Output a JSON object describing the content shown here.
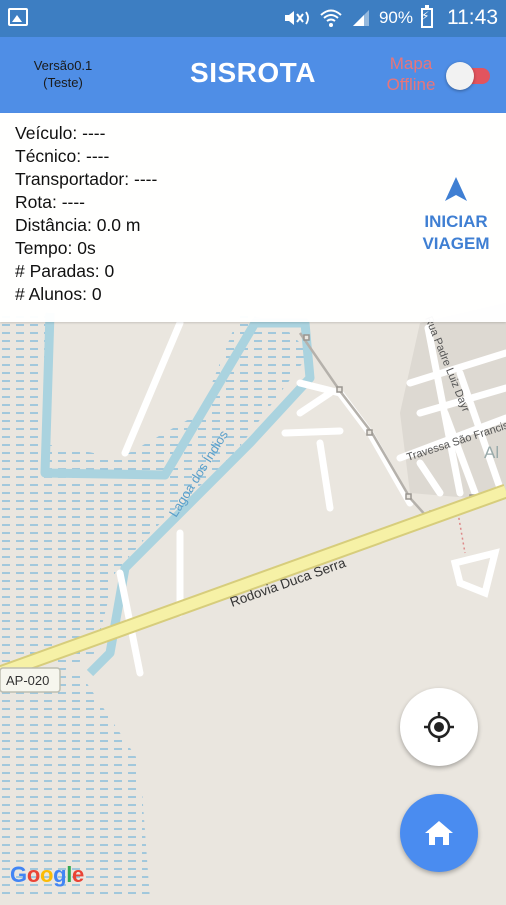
{
  "status_bar": {
    "battery": "90%",
    "time": "11:43"
  },
  "app_bar": {
    "version_line1": "Versão0.1",
    "version_line2": "(Teste)",
    "title": "SISROTA",
    "offline_line1": "Mapa",
    "offline_line2": "Offline",
    "offline_toggle_on": false
  },
  "info": {
    "lines": [
      "Veículo: ----",
      "Técnico: ----",
      "Transportador: ----",
      "Rota: ----",
      "Distância: 0.0 m",
      "Tempo: 0s",
      "# Paradas: 0",
      "# Alunos: 0"
    ],
    "start_line1": "INICIAR",
    "start_line2": "VIAGEM"
  },
  "map": {
    "labels": {
      "lake": "Lagoa dos Índios",
      "highway": "Rodovia Duca Serra",
      "route_shield": "AP-020",
      "street1": "Rua Padre Luiz Dayr",
      "street2": "Travessa São Francisco",
      "district_partial": "Al"
    },
    "attribution": [
      "G",
      "o",
      "o",
      "g",
      "l",
      "e"
    ]
  },
  "icons": {
    "gallery": "image-icon",
    "nav": "navigation-arrow-icon",
    "locate": "my-location-icon",
    "home": "home-icon"
  },
  "colors": {
    "app_bar": "#4f8ee6",
    "status_bar": "#3d7ec2",
    "accent_blue": "#3f7fd3",
    "toggle_red": "#e2545e",
    "water": "#aad3df",
    "road_yellow": "#f6f1a6"
  }
}
